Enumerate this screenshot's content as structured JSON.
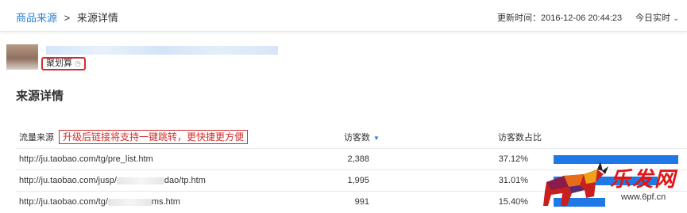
{
  "breadcrumb": {
    "parent": "商品来源",
    "separator": ">",
    "current": "来源详情"
  },
  "header": {
    "update_time": "更新时间：2016-12-06 20:44:23",
    "realtime_label": "今日实时"
  },
  "product": {
    "tag_label": "聚划算"
  },
  "section": {
    "title": "来源详情"
  },
  "table": {
    "col_source": "流量来源",
    "notice": "升级后链接将支持一键跳转，更快捷更方便",
    "col_visitors": "访客数",
    "col_visitor_ratio": "访客数占比",
    "rows": [
      {
        "url_a": "http://ju.taobao.com/tg/pre_list.htm",
        "url_b": "",
        "visitors": "2,388",
        "ratio": "37.12%",
        "ratio_value": 37.12
      },
      {
        "url_a": "http://ju.taobao.com/jusp/",
        "url_b": "dao/tp.htm",
        "visitors": "1,995",
        "ratio": "31.01%",
        "ratio_value": 31.01
      },
      {
        "url_a": "http://ju.taobao.com/tg/",
        "url_b": "ms.htm",
        "visitors": "991",
        "ratio": "15.40%",
        "ratio_value": 15.4
      }
    ]
  },
  "watermark": {
    "brand": "乐发网",
    "url": "www.6pf.cn"
  },
  "colors": {
    "link": "#2a80d8",
    "accent_red": "#d42d2d",
    "bar": "#1e78e6"
  }
}
